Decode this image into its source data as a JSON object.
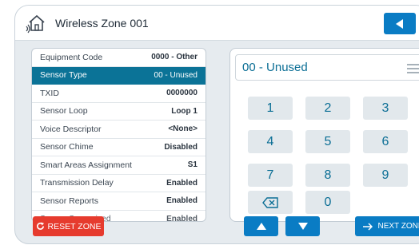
{
  "header": {
    "title": "Wireless Zone 001",
    "icon": "house-wireless-icon",
    "back_icon": "triangle-left-icon"
  },
  "settings": {
    "rows": [
      {
        "label": "Equipment Code",
        "value": "0000 - Other"
      },
      {
        "label": "Sensor Type",
        "value": "00 - Unused",
        "selected": true
      },
      {
        "label": "TXID",
        "value": "0000000"
      },
      {
        "label": "Sensor Loop",
        "value": "Loop 1"
      },
      {
        "label": "Voice Descriptor",
        "value": "<None>"
      },
      {
        "label": "Sensor Chime",
        "value": "Disabled"
      },
      {
        "label": "Smart Areas Assignment",
        "value": "S1"
      },
      {
        "label": "Transmission Delay",
        "value": "Enabled"
      },
      {
        "label": "Sensor Reports",
        "value": "Enabled"
      },
      {
        "label": "Sensor Supervised",
        "value": "Enabled"
      }
    ]
  },
  "keypad": {
    "display_value": "00 - Unused",
    "menu_icon": "hamburger-menu-icon",
    "keys": [
      "1",
      "2",
      "3",
      "4",
      "5",
      "6",
      "7",
      "8",
      "9",
      "0"
    ],
    "backspace_icon": "backspace-icon"
  },
  "footer": {
    "reset_label": "RESET ZONE",
    "reset_icon": "refresh-icon",
    "up_icon": "triangle-up-icon",
    "down_icon": "triangle-down-icon",
    "next_label": "NEXT ZONE",
    "next_icon": "arrow-right-icon"
  },
  "colors": {
    "accent": "#0a7cc4",
    "selected_row": "#0b7397",
    "danger": "#e63b2e",
    "key_background": "#e2e8ec"
  }
}
